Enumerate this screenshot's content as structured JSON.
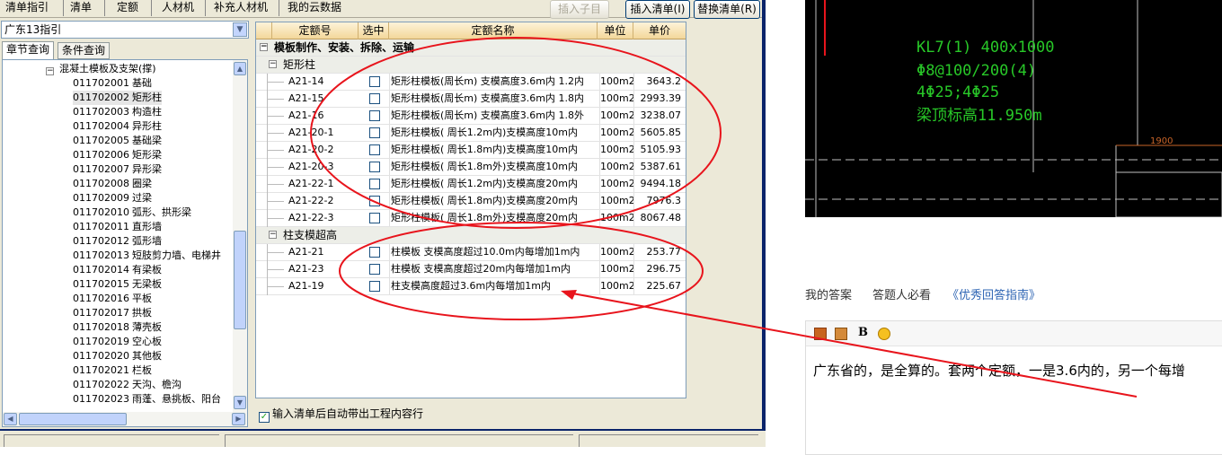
{
  "toolbar": {
    "tabs": [
      "清单指引",
      "清单",
      "定额",
      "人材机",
      "补充人材机",
      "我的云数据"
    ],
    "insert_child": "插入子目",
    "insert_list": "插入清单(I)",
    "replace_list": "替换清单(R)"
  },
  "left": {
    "region": "广东13指引",
    "tab_chapter": "章节查询",
    "tab_condition": "条件查询",
    "tree_parent": "混凝土模板及支架(撑)",
    "items": [
      {
        "code": "011702001",
        "name": "基础"
      },
      {
        "code": "011702002",
        "name": "矩形柱"
      },
      {
        "code": "011702003",
        "name": "构造柱"
      },
      {
        "code": "011702004",
        "name": "异形柱"
      },
      {
        "code": "011702005",
        "name": "基础梁"
      },
      {
        "code": "011702006",
        "name": "矩形梁"
      },
      {
        "code": "011702007",
        "name": "异形梁"
      },
      {
        "code": "011702008",
        "name": "圈梁"
      },
      {
        "code": "011702009",
        "name": "过梁"
      },
      {
        "code": "011702010",
        "name": "弧形、拱形梁"
      },
      {
        "code": "011702011",
        "name": "直形墙"
      },
      {
        "code": "011702012",
        "name": "弧形墙"
      },
      {
        "code": "011702013",
        "name": "短肢剪力墙、电梯井"
      },
      {
        "code": "011702014",
        "name": "有梁板"
      },
      {
        "code": "011702015",
        "name": "无梁板"
      },
      {
        "code": "011702016",
        "name": "平板"
      },
      {
        "code": "011702017",
        "name": "拱板"
      },
      {
        "code": "011702018",
        "name": "薄壳板"
      },
      {
        "code": "011702019",
        "name": "空心板"
      },
      {
        "code": "011702020",
        "name": "其他板"
      },
      {
        "code": "011702021",
        "name": "栏板"
      },
      {
        "code": "011702022",
        "name": "天沟、檐沟"
      },
      {
        "code": "011702023",
        "name": "雨蓬、悬挑板、阳台"
      }
    ]
  },
  "grid": {
    "headers": {
      "code": "定额号",
      "select": "选中",
      "name": "定额名称",
      "unit": "单位",
      "price": "单价"
    },
    "category": "模板制作、安装、拆除、运输",
    "groups": [
      {
        "title": "矩形柱",
        "rows": [
          {
            "code": "A21-14",
            "name": "矩形柱模板(周长m) 支模高度3.6m内 1.2内",
            "unit": "100m2",
            "price": "3643.2"
          },
          {
            "code": "A21-15",
            "name": "矩形柱模板(周长m) 支模高度3.6m内 1.8内",
            "unit": "100m2",
            "price": "2993.39"
          },
          {
            "code": "A21-16",
            "name": "矩形柱模板(周长m) 支模高度3.6m内 1.8外",
            "unit": "100m2",
            "price": "3238.07"
          },
          {
            "code": "A21-20-1",
            "name": "矩形柱模板( 周长1.2m内)支模高度10m内",
            "unit": "100m2",
            "price": "5605.85"
          },
          {
            "code": "A21-20-2",
            "name": "矩形柱模板( 周长1.8m内)支模高度10m内",
            "unit": "100m2",
            "price": "5105.93"
          },
          {
            "code": "A21-20-3",
            "name": "矩形柱模板( 周长1.8m外)支模高度10m内",
            "unit": "100m2",
            "price": "5387.61"
          },
          {
            "code": "A21-22-1",
            "name": "矩形柱模板( 周长1.2m内)支模高度20m内",
            "unit": "100m2",
            "price": "9494.18"
          },
          {
            "code": "A21-22-2",
            "name": "矩形柱模板( 周长1.8m内)支模高度20m内",
            "unit": "100m2",
            "price": "7976.3"
          },
          {
            "code": "A21-22-3",
            "name": "矩形柱模板( 周长1.8m外)支模高度20m内",
            "unit": "100m2",
            "price": "8067.48"
          }
        ]
      },
      {
        "title": "柱支模超高",
        "rows": [
          {
            "code": "A21-21",
            "name": "柱模板 支模高度超过10.0m内每增加1m内",
            "unit": "100m2",
            "price": "253.77"
          },
          {
            "code": "A21-23",
            "name": "柱模板 支模高度超过20m内每增加1m内",
            "unit": "100m2",
            "price": "296.75"
          },
          {
            "code": "A21-19",
            "name": "柱支模高度超过3.6m内每增加1m内",
            "unit": "100m2",
            "price": "225.67"
          }
        ]
      }
    ]
  },
  "auto_option": "输入清单后自动带出工程内容行",
  "cad": {
    "lines": [
      "KL7(1) 400x1000",
      "Φ8@100/200(4)",
      "4Φ25;4Φ25",
      "梁顶标高11.950m"
    ],
    "dim": "1900"
  },
  "answer": {
    "tabs": [
      "我的答案",
      "答题人必看",
      "《优秀回答指南》"
    ],
    "bold_label": "B",
    "text": "广东省的，是全算的。套两个定额，一是3.6内的，另一个每增"
  },
  "colors": {
    "annotation": "#e8141c",
    "frame": "#0a246a",
    "cad_text": "#28c828"
  }
}
